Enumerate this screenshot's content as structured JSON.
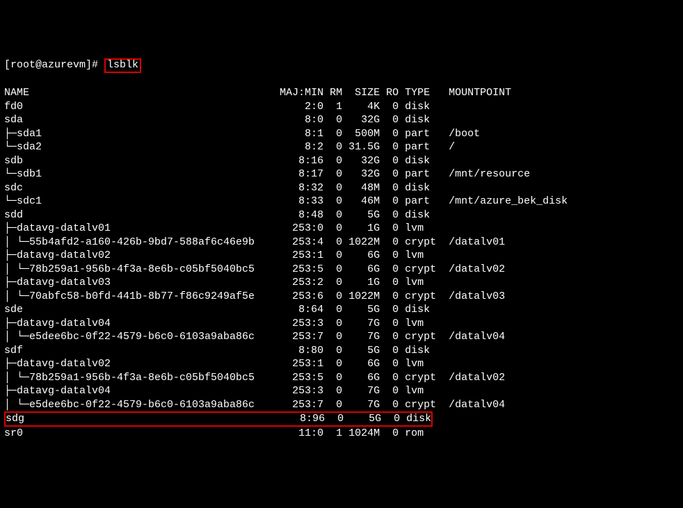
{
  "prompt": "[root@azurevm]# ",
  "command": "lsblk",
  "header": {
    "n": "NAME",
    "mm": "MAJ:MIN",
    "rm": "RM",
    "sz": "SIZE",
    "ro": "RO",
    "tp": "TYPE",
    "mp": "MOUNTPOINT"
  },
  "rows": [
    {
      "name": "fd0",
      "mm": "2:0",
      "rm": "1",
      "sz": "4K",
      "ro": "0",
      "tp": "disk",
      "mp": ""
    },
    {
      "name": "sda",
      "mm": "8:0",
      "rm": "0",
      "sz": "32G",
      "ro": "0",
      "tp": "disk",
      "mp": ""
    },
    {
      "name": "├─sda1",
      "mm": "8:1",
      "rm": "0",
      "sz": "500M",
      "ro": "0",
      "tp": "part",
      "mp": "/boot"
    },
    {
      "name": "└─sda2",
      "mm": "8:2",
      "rm": "0",
      "sz": "31.5G",
      "ro": "0",
      "tp": "part",
      "mp": "/"
    },
    {
      "name": "sdb",
      "mm": "8:16",
      "rm": "0",
      "sz": "32G",
      "ro": "0",
      "tp": "disk",
      "mp": ""
    },
    {
      "name": "└─sdb1",
      "mm": "8:17",
      "rm": "0",
      "sz": "32G",
      "ro": "0",
      "tp": "part",
      "mp": "/mnt/resource"
    },
    {
      "name": "sdc",
      "mm": "8:32",
      "rm": "0",
      "sz": "48M",
      "ro": "0",
      "tp": "disk",
      "mp": ""
    },
    {
      "name": "└─sdc1",
      "mm": "8:33",
      "rm": "0",
      "sz": "46M",
      "ro": "0",
      "tp": "part",
      "mp": "/mnt/azure_bek_disk"
    },
    {
      "name": "sdd",
      "mm": "8:48",
      "rm": "0",
      "sz": "5G",
      "ro": "0",
      "tp": "disk",
      "mp": ""
    },
    {
      "name": "├─datavg-datalv01",
      "mm": "253:0",
      "rm": "0",
      "sz": "1G",
      "ro": "0",
      "tp": "lvm",
      "mp": ""
    },
    {
      "name": "│ └─55b4afd2-a160-426b-9bd7-588af6c46e9b",
      "mm": "253:4",
      "rm": "0",
      "sz": "1022M",
      "ro": "0",
      "tp": "crypt",
      "mp": "/datalv01"
    },
    {
      "name": "├─datavg-datalv02",
      "mm": "253:1",
      "rm": "0",
      "sz": "6G",
      "ro": "0",
      "tp": "lvm",
      "mp": ""
    },
    {
      "name": "│ └─78b259a1-956b-4f3a-8e6b-c05bf5040bc5",
      "mm": "253:5",
      "rm": "0",
      "sz": "6G",
      "ro": "0",
      "tp": "crypt",
      "mp": "/datalv02"
    },
    {
      "name": "├─datavg-datalv03",
      "mm": "253:2",
      "rm": "0",
      "sz": "1G",
      "ro": "0",
      "tp": "lvm",
      "mp": ""
    },
    {
      "name": "│ └─70abfc58-b0fd-441b-8b77-f86c9249af5e",
      "mm": "253:6",
      "rm": "0",
      "sz": "1022M",
      "ro": "0",
      "tp": "crypt",
      "mp": "/datalv03"
    },
    {
      "name": "sde",
      "mm": "8:64",
      "rm": "0",
      "sz": "5G",
      "ro": "0",
      "tp": "disk",
      "mp": ""
    },
    {
      "name": "├─datavg-datalv04",
      "mm": "253:3",
      "rm": "0",
      "sz": "7G",
      "ro": "0",
      "tp": "lvm",
      "mp": ""
    },
    {
      "name": "│ └─e5dee6bc-0f22-4579-b6c0-6103a9aba86c",
      "mm": "253:7",
      "rm": "0",
      "sz": "7G",
      "ro": "0",
      "tp": "crypt",
      "mp": "/datalv04"
    },
    {
      "name": "sdf",
      "mm": "8:80",
      "rm": "0",
      "sz": "5G",
      "ro": "0",
      "tp": "disk",
      "mp": ""
    },
    {
      "name": "├─datavg-datalv02",
      "mm": "253:1",
      "rm": "0",
      "sz": "6G",
      "ro": "0",
      "tp": "lvm",
      "mp": ""
    },
    {
      "name": "│ └─78b259a1-956b-4f3a-8e6b-c05bf5040bc5",
      "mm": "253:5",
      "rm": "0",
      "sz": "6G",
      "ro": "0",
      "tp": "crypt",
      "mp": "/datalv02"
    },
    {
      "name": "├─datavg-datalv04",
      "mm": "253:3",
      "rm": "0",
      "sz": "7G",
      "ro": "0",
      "tp": "lvm",
      "mp": ""
    },
    {
      "name": "│ └─e5dee6bc-0f22-4579-b6c0-6103a9aba86c",
      "mm": "253:7",
      "rm": "0",
      "sz": "7G",
      "ro": "0",
      "tp": "crypt",
      "mp": "/datalv04"
    },
    {
      "name": "sdg",
      "mm": "8:96",
      "rm": "0",
      "sz": "5G",
      "ro": "0",
      "tp": "disk",
      "mp": "",
      "hl": true
    },
    {
      "name": "sr0",
      "mm": "11:0",
      "rm": "1",
      "sz": "1024M",
      "ro": "0",
      "tp": "rom",
      "mp": ""
    }
  ]
}
